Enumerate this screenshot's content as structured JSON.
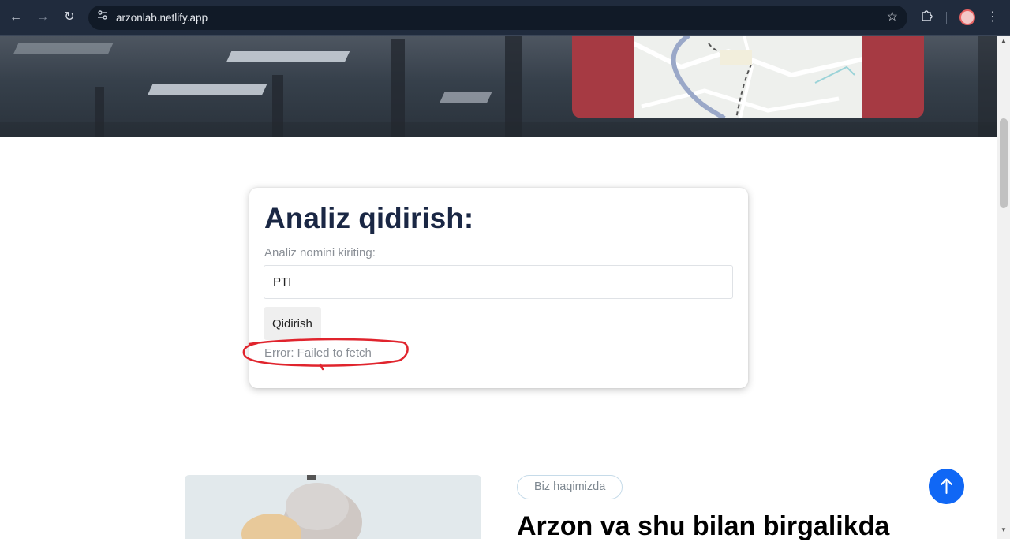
{
  "browser": {
    "url": "arzonlab.netlify.app",
    "icons": {
      "back": "back-arrow-icon",
      "forward": "forward-arrow-icon",
      "reload": "reload-icon",
      "site_info": "tune-icon",
      "bookmark": "star-icon",
      "extensions": "puzzle-icon",
      "menu": "kebab-menu-icon"
    }
  },
  "search_card": {
    "title": "Analiz qidirish:",
    "label": "Analiz nomini kiriting:",
    "input_value": "PTI",
    "button_label": "Qidirish",
    "error": "Error: Failed to fetch"
  },
  "about": {
    "badge": "Biz haqimizda",
    "heading": "Arzon va shu bilan birgalikda"
  },
  "colors": {
    "title": "#1a2744",
    "accent": "#1067f5",
    "annotation": "#e0242d",
    "hero_card": "#a63a43"
  }
}
